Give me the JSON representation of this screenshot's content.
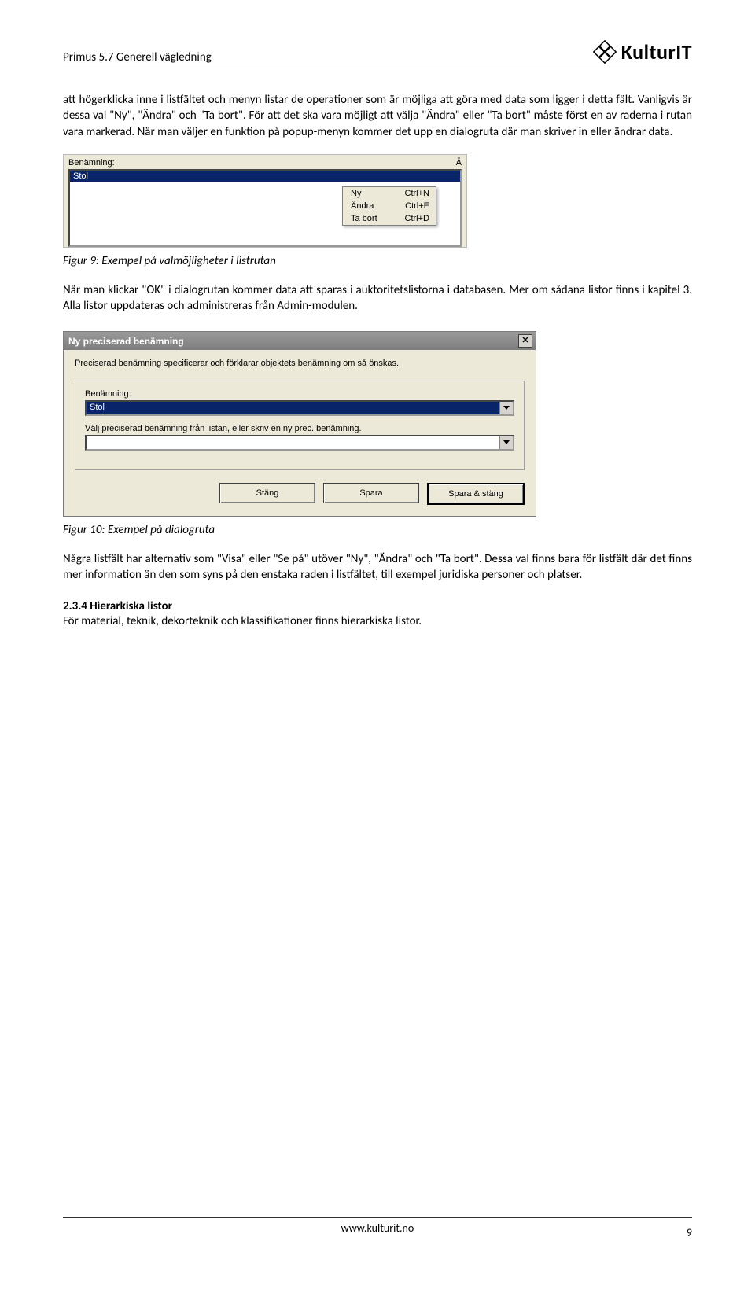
{
  "header": {
    "title": "Primus 5.7 Generell vägledning",
    "brand": "KulturIT"
  },
  "para1": "att högerklicka inne i listfältet och menyn listar de operationer som är möjliga att göra med data som ligger i detta fält. Vanligvis är dessa val \"Ny\", \"Ändra\" och \"Ta bort\". För att det ska vara möjligt att välja \"Ändra\" eller \"Ta bort\" måste först en av raderna i rutan vara markerad. När man väljer en funktion på popup-menyn kommer det upp en dialogruta där man skriver in eller ändrar data.",
  "fig9": {
    "label_left": "Benämning:",
    "label_right": "Ä",
    "selected": "Stol",
    "menu": [
      {
        "label": "Ny",
        "shortcut": "Ctrl+N"
      },
      {
        "label": "Ändra",
        "shortcut": "Ctrl+E"
      },
      {
        "label": "Ta bort",
        "shortcut": "Ctrl+D"
      }
    ],
    "caption": "Figur 9: Exempel på valmöjligheter i listrutan"
  },
  "para2": "När man klickar \"OK\" i dialogrutan kommer data att sparas i auktoritetslistorna i databasen. Mer om sådana listor finns i kapitel 3. Alla listor uppdateras och administreras från Admin-modulen.",
  "fig10": {
    "title": "Ny preciserad benämning",
    "help": "Preciserad benämning specificerar och förklarar objektets benämning om så önskas.",
    "field1_label": "Benämning:",
    "field1_value": "Stol",
    "field2_label": "Välj preciserad benämning från listan, eller skriv en ny prec. benämning.",
    "field2_value": "",
    "buttons": {
      "close": "Stäng",
      "save": "Spara",
      "save_close": "Spara & stäng"
    },
    "caption": "Figur 10: Exempel på dialogruta"
  },
  "para3": "Några listfält har alternativ som \"Visa\" eller \"Se på\" utöver \"Ny\", \"Ändra\" och \"Ta bort\". Dessa val finns bara för listfält där det finns mer information än den som syns på den enstaka raden i listfältet, till exempel juridiska personer och platser.",
  "section": {
    "heading": "2.3.4 Hierarkiska listor",
    "text": "För material, teknik, dekorteknik och klassifikationer finns hierarkiska listor."
  },
  "footer": {
    "url": "www.kulturit.no",
    "page": "9"
  }
}
